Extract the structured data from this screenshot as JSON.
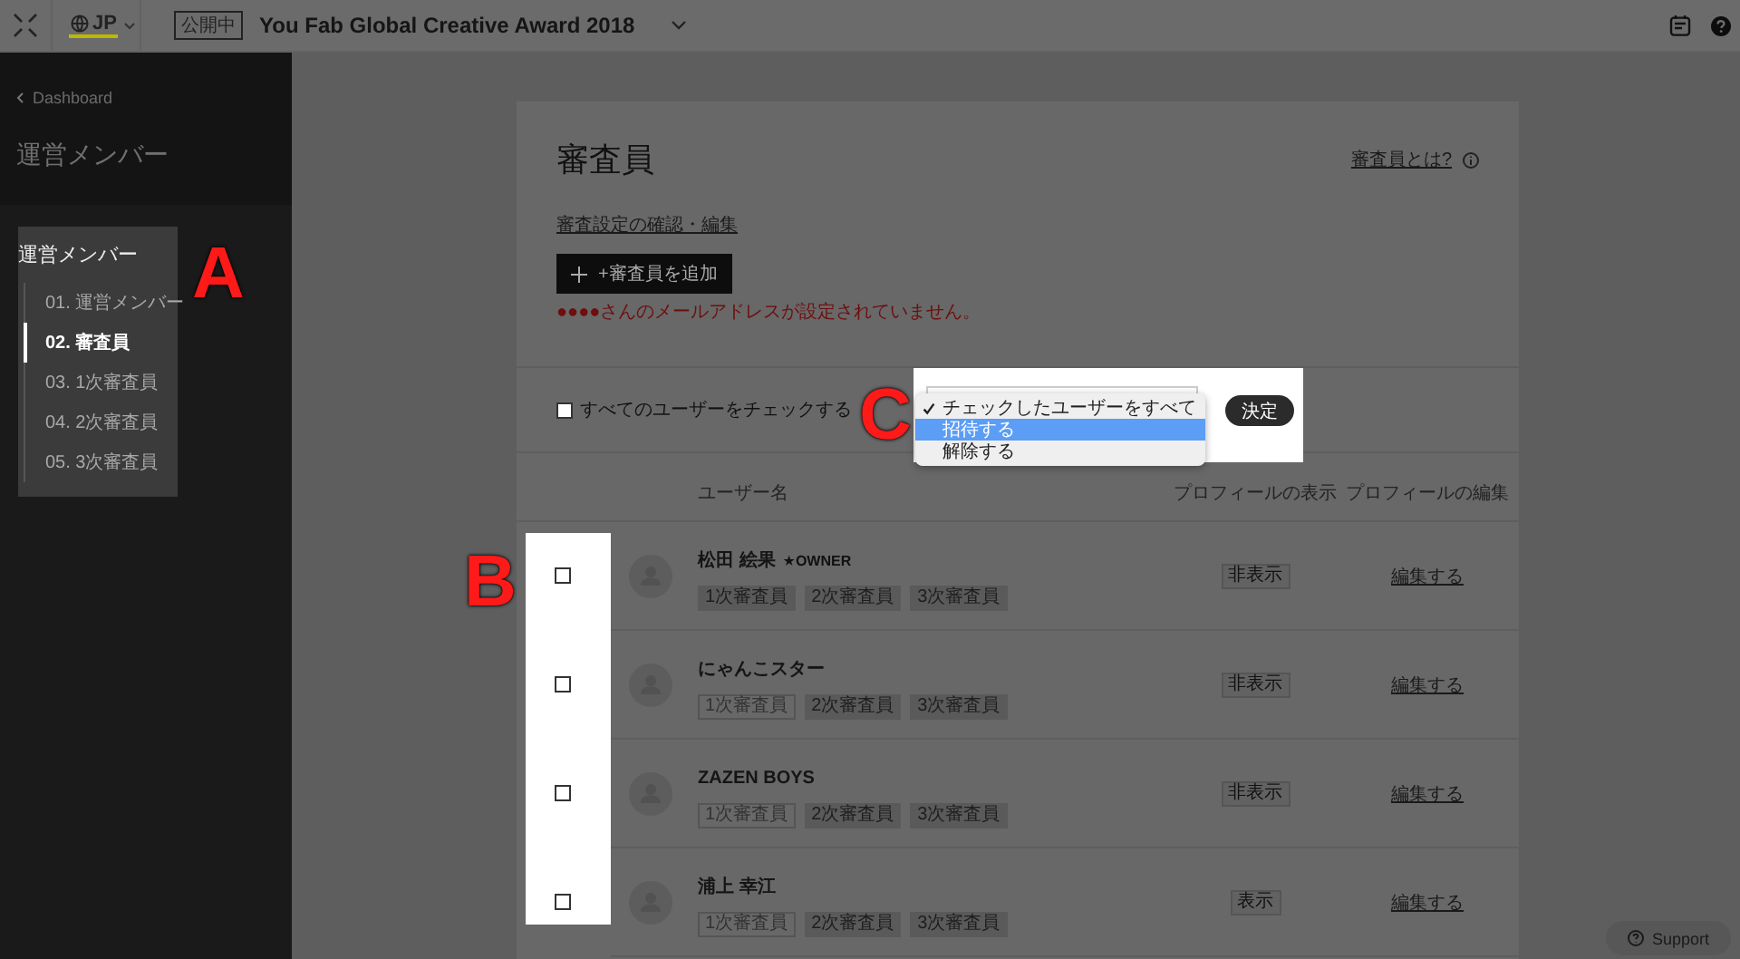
{
  "topbar": {
    "language": "JP",
    "status_badge": "公開中",
    "project_title": "You Fab Global Creative Award 2018"
  },
  "sidebar": {
    "back_link": "Dashboard",
    "title": "運営メンバー",
    "section": {
      "heading": "運営メンバー",
      "items": [
        {
          "label": "01. 運営メンバー",
          "selected": false
        },
        {
          "label": "02. 審査員",
          "selected": true
        },
        {
          "label": "03. 1次審査員",
          "selected": false
        },
        {
          "label": "04. 2次審査員",
          "selected": false
        },
        {
          "label": "05. 3次審査員",
          "selected": false
        }
      ]
    }
  },
  "page": {
    "title": "審査員",
    "help_link": "審査員とは?",
    "settings_link": "審査設定の確認・編集",
    "add_button": "+審査員を追加",
    "error": "●●●●さんのメールアドレスが設定されていません。"
  },
  "bulk": {
    "check_all_label": "すべてのユーザーをチェックする",
    "check_all": false,
    "options": [
      {
        "label": "チェックしたユーザーをすべて",
        "checked": true,
        "selected": false
      },
      {
        "label": "招待する",
        "checked": false,
        "selected": true
      },
      {
        "label": "解除する",
        "checked": false,
        "selected": false
      }
    ],
    "submit": "決定"
  },
  "table": {
    "columns": [
      "ユーザー名",
      "プロフィールの表示",
      "プロフィールの編集"
    ],
    "rows": [
      {
        "name": "松田 絵果",
        "badge": "★OWNER",
        "checked": false,
        "tags": [
          {
            "label": "1次審査員",
            "selected": true
          },
          {
            "label": "2次審査員",
            "selected": true
          },
          {
            "label": "3次審査員",
            "selected": true
          }
        ],
        "visibility": "非表示",
        "edit_link": "編集する"
      },
      {
        "name": "にゃんこスター",
        "checked": false,
        "tags": [
          {
            "label": "1次審査員",
            "selected": false
          },
          {
            "label": "2次審査員",
            "selected": true
          },
          {
            "label": "3次審査員",
            "selected": true
          }
        ],
        "visibility": "非表示",
        "edit_link": "編集する"
      },
      {
        "name": "ZAZEN BOYS",
        "checked": false,
        "tags": [
          {
            "label": "1次審査員",
            "selected": false
          },
          {
            "label": "2次審査員",
            "selected": true
          },
          {
            "label": "3次審査員",
            "selected": true
          }
        ],
        "visibility": "非表示",
        "edit_link": "編集する"
      },
      {
        "name": "浦上 幸江",
        "checked": false,
        "tags": [
          {
            "label": "1次審査員",
            "selected": false
          },
          {
            "label": "2次審査員",
            "selected": true
          },
          {
            "label": "3次審査員",
            "selected": true
          }
        ],
        "visibility": "表示",
        "edit_link": "編集する"
      }
    ]
  },
  "annotations": [
    {
      "label": "A"
    },
    {
      "label": "B"
    },
    {
      "label": "C"
    }
  ],
  "support_button": "Support"
}
